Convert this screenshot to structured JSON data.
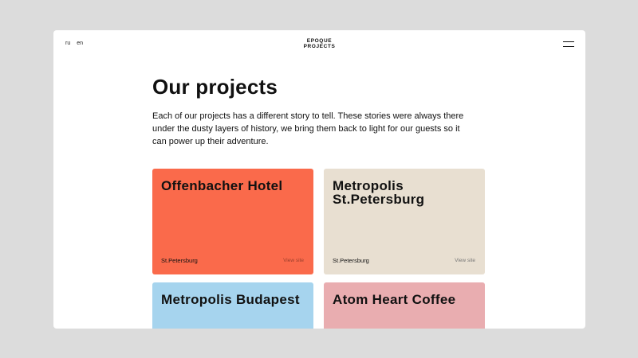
{
  "header": {
    "languages": [
      "ru",
      "en"
    ],
    "logo_line1": "EPOQUE",
    "logo_line2": "PROJECTS",
    "menu_icon": "hamburger-icon"
  },
  "main": {
    "title": "Our projects",
    "intro": "Each of our projects has a different story to tell. These stories were always there under the dusty layers of history, we bring them back to light for our guests so it can power up their adventure."
  },
  "projects": [
    {
      "name": "Offenbacher Hotel",
      "city": "St.Petersburg",
      "link": "View site",
      "color": "#fa6a4b"
    },
    {
      "name": "Metropolis St.Petersburg",
      "city": "St.Petersburg",
      "link": "View site",
      "color": "#e8dfd1"
    },
    {
      "name": "Metropolis Budapest",
      "color": "#a6d4ee"
    },
    {
      "name": "Atom Heart Coffee",
      "color": "#e9adb0"
    }
  ]
}
